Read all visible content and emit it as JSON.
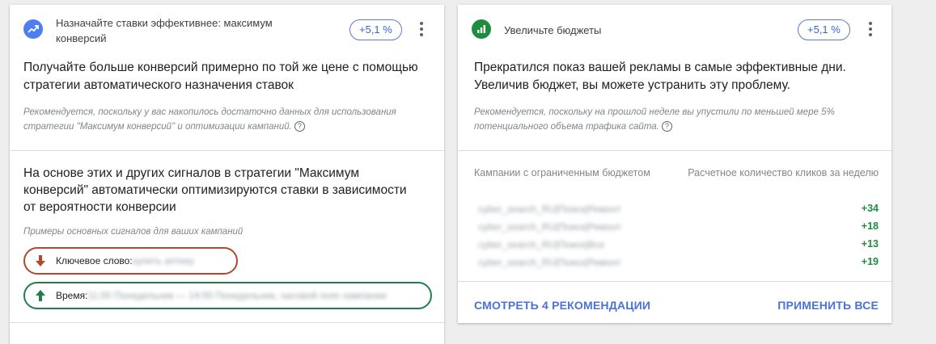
{
  "cards": [
    {
      "icon": "trending-up-icon",
      "icon_color": "#4f7ef0",
      "title": "Назначайте ставки эффективнее: максимум конверсий",
      "badge": "+5,1 %",
      "headline": "Получайте больше конверсий примерно по той же цене с помощью стратегии автоматического назначения ставок",
      "note": "Рекомендуется, поскольку у вас накопилось достаточно данных для использования стратегии \"Максимум конверсий\" и оптимизации кампаний.",
      "body": "На основе этих и других сигналов в стратегии \"Максимум конверсий\" автоматически оптимизируются ставки в зависимости от вероятности конверсии",
      "signals_label": "Примеры основных сигналов для ваших кампаний",
      "signals": [
        {
          "label": "Ключевое слово:",
          "value": "купить аптеку",
          "direction": "down",
          "color": "#b3472e"
        },
        {
          "label": "Время:",
          "value": "11:00 Понедельник — 14:00 Понедельник, часовой пояс кампании",
          "direction": "up",
          "color": "#1e7f4a"
        }
      ]
    },
    {
      "icon": "bar-chart-icon",
      "icon_color": "#1e8e3e",
      "title": "Увеличьте бюджеты",
      "badge": "+5,1 %",
      "headline": "Прекратился показ вашей рекламы в самые эффективные дни. Увеличив бюджет, вы можете устранить эту проблему.",
      "note": "Рекомендуется, поскольку на прошлой неделе вы упустили по меньшей мере 5% потенциального объема трафика сайта.",
      "table": {
        "col1": "Кампании с ограниченным бюджетом",
        "col2": "Расчетное количество кликов за неделю",
        "rows": [
          {
            "name": "cyber_search_RU|Поиск|Ремонт",
            "value": "+34"
          },
          {
            "name": "cyber_search_RU|Поиск|Ремонт",
            "value": "+18"
          },
          {
            "name": "cyber_search_RU|Поиск|Все",
            "value": "+13"
          },
          {
            "name": "cyber_search_RU|Поиск|Ремонт",
            "value": "+19"
          }
        ]
      },
      "actions": {
        "view_all": "СМОТРЕТЬ 4 РЕКОМЕНДАЦИИ",
        "apply_all": "ПРИМЕНИТЬ ВСЕ"
      }
    }
  ]
}
